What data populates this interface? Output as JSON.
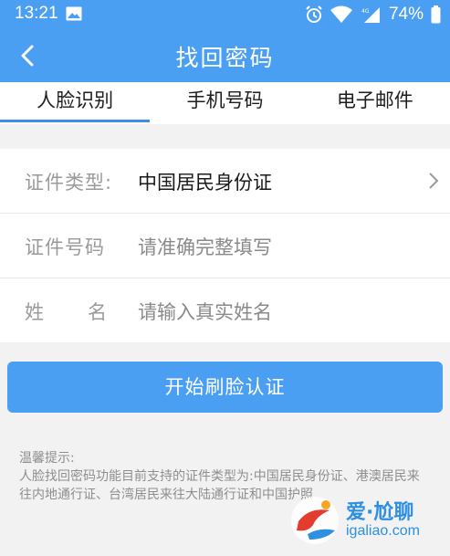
{
  "status_bar": {
    "time": "13:21",
    "battery": "74%",
    "icons": [
      "image-icon",
      "alarm-icon",
      "wifi-icon",
      "signal-icon",
      "battery-icon"
    ]
  },
  "header": {
    "title": "找回密码",
    "back_icon": "chevron-left-icon"
  },
  "tabs": [
    {
      "label": "人脸识别",
      "active": true
    },
    {
      "label": "手机号码",
      "active": false
    },
    {
      "label": "电子邮件",
      "active": false
    }
  ],
  "form": {
    "id_type": {
      "label": "证件类型:",
      "value": "中国居民身份证"
    },
    "id_number": {
      "label": "证件号码",
      "placeholder": "请准确完整填写"
    },
    "name": {
      "label_char_1": "姓",
      "label_char_2": "名",
      "placeholder": "请输入真实姓名"
    }
  },
  "start_button": "开始刷脸认证",
  "tips": {
    "title": "温馨提示:",
    "body": "人脸找回密码功能目前支持的证件类型为:中国居民身份证、港澳居民来往内地通行证、台湾居民来往大陆通行证和中国护照"
  },
  "watermark": {
    "cn": "爱·尬聊",
    "en": "igaliao.com"
  },
  "colors": {
    "brand": "#4a9ff2",
    "tab_indicator": "#3c8ee8",
    "background": "#f2f2f2"
  }
}
